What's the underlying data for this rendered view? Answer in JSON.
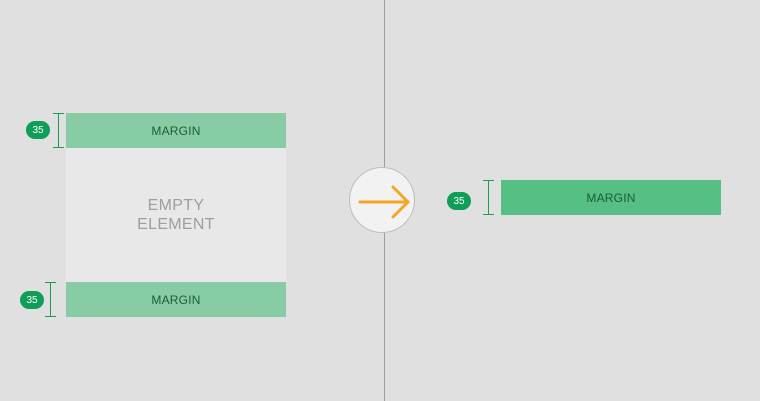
{
  "left": {
    "top_margin_label": "MARGIN",
    "empty_element_label": "EMPTY\nELEMENT",
    "bottom_margin_label": "MARGIN",
    "top_measure_value": "35",
    "bottom_measure_value": "35"
  },
  "right": {
    "margin_label": "MARGIN",
    "measure_value": "35"
  },
  "colors": {
    "background": "#e0e0e0",
    "margin_light": "#88cca5",
    "margin_solid": "#55bf84",
    "badge": "#0f9d58",
    "arrow": "#f5a623"
  },
  "icons": {
    "center": "arrow-right-icon"
  }
}
